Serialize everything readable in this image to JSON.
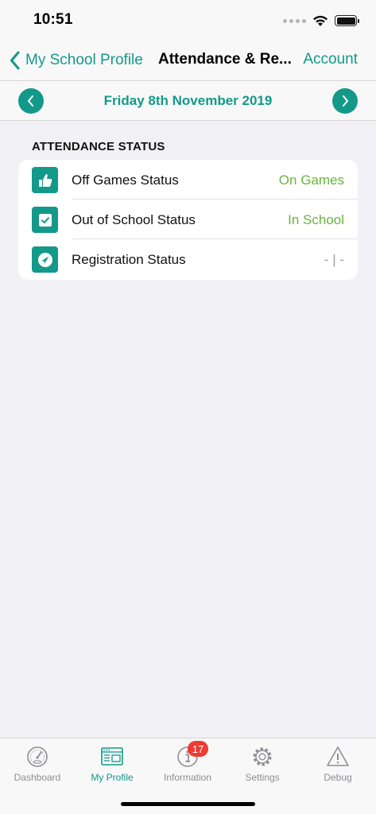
{
  "status_bar": {
    "time": "10:51"
  },
  "nav": {
    "back_label": "My School Profile",
    "title": "Attendance & Re...",
    "account_label": "Account"
  },
  "date_bar": {
    "date": "Friday 8th November 2019"
  },
  "attendance": {
    "section_title": "ATTENDANCE STATUS",
    "rows": [
      {
        "icon": "thumbs-up-icon",
        "label": "Off Games Status",
        "value": "On Games"
      },
      {
        "icon": "check-badge-icon",
        "label": "Out of School Status",
        "value": "In School"
      },
      {
        "icon": "location-arrow-icon",
        "label": "Registration Status",
        "value": "- | -"
      }
    ]
  },
  "tabs": [
    {
      "label": "Dashboard",
      "icon": "speedometer-icon",
      "active": false
    },
    {
      "label": "My Profile",
      "icon": "profile-card-icon",
      "active": true
    },
    {
      "label": "Information",
      "icon": "info-icon",
      "active": false,
      "badge": "17"
    },
    {
      "label": "Settings",
      "icon": "gear-icon",
      "active": false
    },
    {
      "label": "Debug",
      "icon": "warning-icon",
      "active": false
    }
  ],
  "colors": {
    "accent": "#13998a",
    "positive": "#6bb33e",
    "neutral_value": "#9a9a9a",
    "badge": "#ef3b33",
    "background": "#f0f0f5"
  }
}
